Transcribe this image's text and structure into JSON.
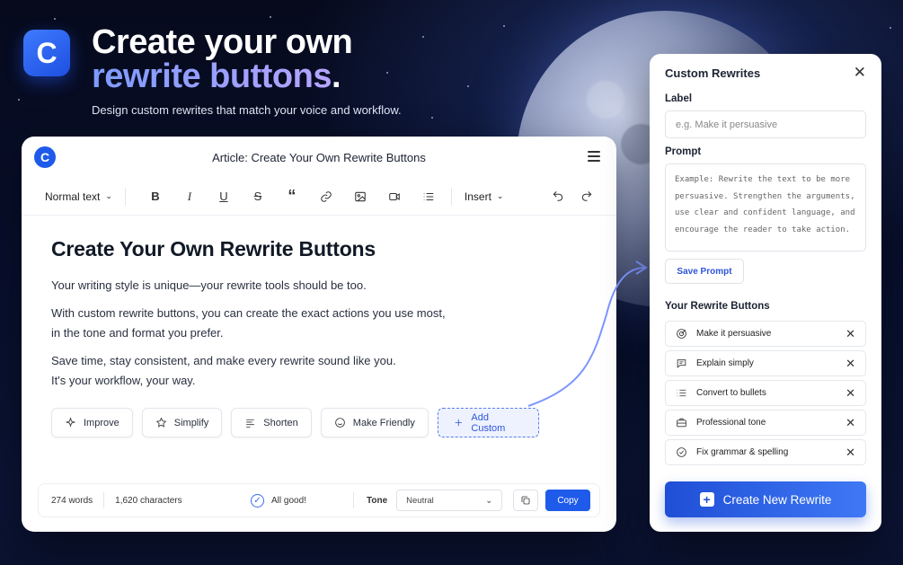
{
  "hero": {
    "logo_letter": "C",
    "title_line1": "Create your own",
    "title_line2": "rewrite buttons",
    "title_period": ".",
    "subtitle": "Design custom rewrites that match your voice and workflow."
  },
  "editor": {
    "logo_letter": "C",
    "title": "Article: Create Your Own Rewrite Buttons",
    "toolbar": {
      "style_select": "Normal text",
      "insert_select": "Insert",
      "icons": [
        "bold-icon",
        "italic-icon",
        "underline-icon",
        "strikethrough-icon",
        "quote-icon",
        "link-icon",
        "image-icon",
        "video-icon",
        "list-icon",
        "undo-icon",
        "redo-icon"
      ]
    },
    "doc": {
      "heading": "Create Your Own Rewrite Buttons",
      "p1": "Your writing style is unique—your rewrite tools should be too.",
      "p2_l1": "With custom rewrite buttons, you can create the exact actions you use most,",
      "p2_l2": "in the tone and format you prefer.",
      "p3_l1": "Save time, stay consistent, and make every rewrite sound like you.",
      "p3_l2": "It's your workflow, your way."
    },
    "actions": [
      {
        "label": "Improve",
        "icon": "sparkle-icon"
      },
      {
        "label": "Simplify",
        "icon": "star-icon"
      },
      {
        "label": "Shorten",
        "icon": "lines-icon"
      },
      {
        "label": "Make Friendly",
        "icon": "smile-icon"
      },
      {
        "label": "Add Custom",
        "icon": "plus-icon"
      }
    ],
    "status": {
      "words": "274 words",
      "characters": "1,620 characters",
      "check": "All good!",
      "tone_label": "Tone",
      "tone_value": "Neutral",
      "copy_label": "Copy"
    }
  },
  "panel": {
    "title": "Custom Rewrites",
    "label_heading": "Label",
    "label_placeholder": "e.g. Make it persuasive",
    "prompt_heading": "Prompt",
    "prompt_lines": [
      "Example:  Rewrite the text to be more",
      "persuasive. Strengthen the arguments,",
      "use clear and confident language, and",
      "encourage the reader to take action."
    ],
    "save_label": "Save Prompt",
    "buttons_heading": "Your Rewrite Buttons",
    "buttons": [
      {
        "label": "Make it persuasive",
        "icon": "target-icon"
      },
      {
        "label": "Explain simply",
        "icon": "chat-icon"
      },
      {
        "label": "Convert to bullets",
        "icon": "bullets-icon"
      },
      {
        "label": "Professional tone",
        "icon": "briefcase-icon"
      },
      {
        "label": "Fix grammar & spelling",
        "icon": "check-circle-icon"
      }
    ],
    "create_label": "Create New Rewrite"
  },
  "colors": {
    "accent": "#1f5bea",
    "accent_light": "#eef2ff",
    "background": "#081030"
  }
}
